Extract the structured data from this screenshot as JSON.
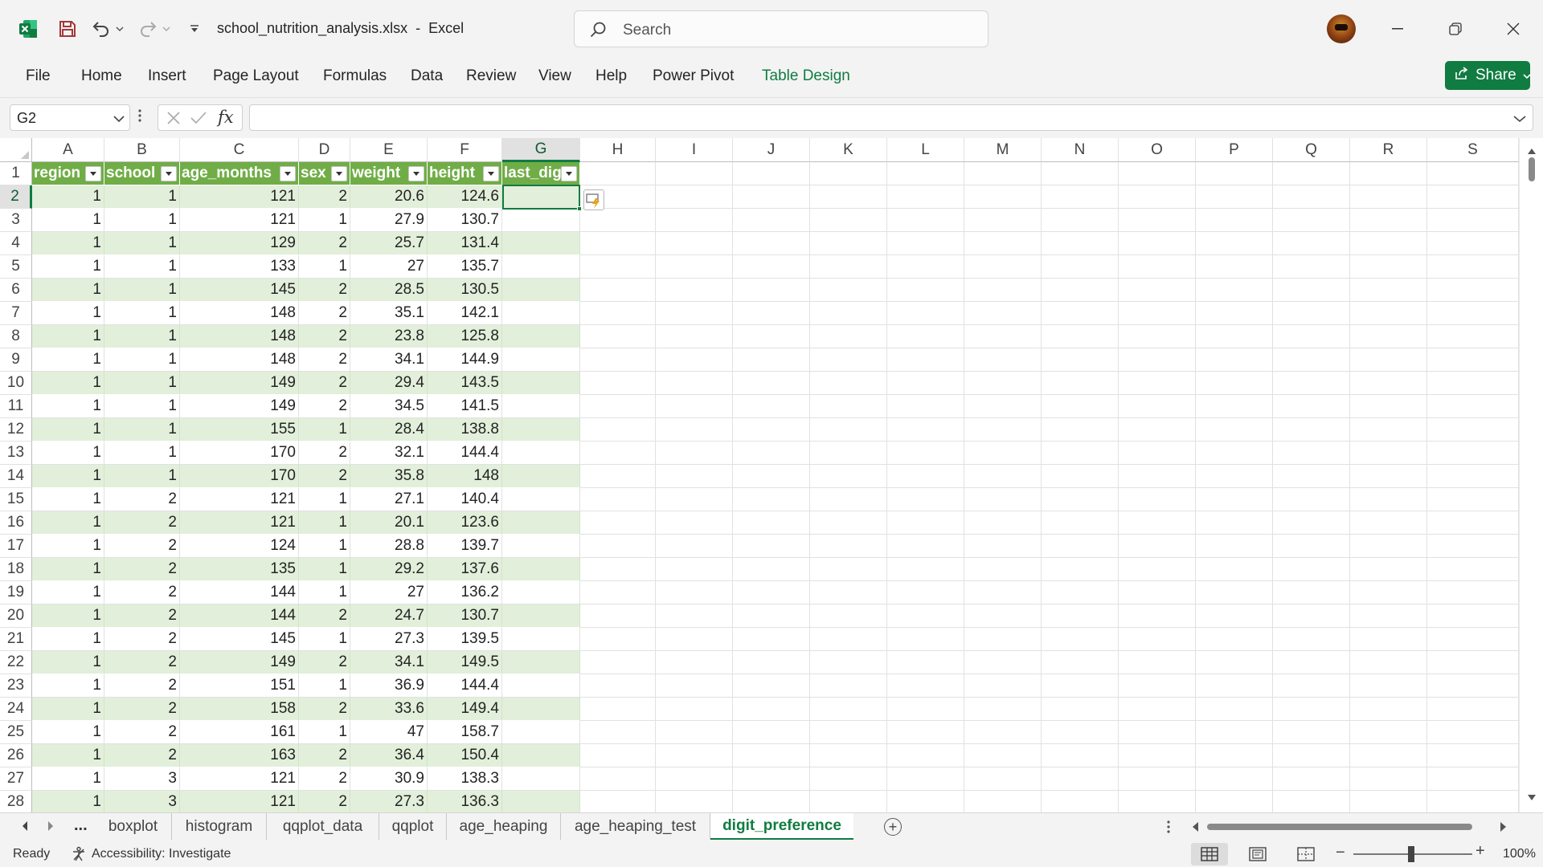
{
  "titlebar": {
    "filename": "school_nutrition_analysis.xlsx",
    "separator": "-",
    "app_name": "Excel",
    "search_placeholder": "Search"
  },
  "ribbon": {
    "tabs": [
      "File",
      "Home",
      "Insert",
      "Page Layout",
      "Formulas",
      "Data",
      "Review",
      "View",
      "Help",
      "Power Pivot",
      "Table Design"
    ],
    "active_contextual_tab": "Table Design",
    "share_label": "Share"
  },
  "formula_bar": {
    "name_box": "G2",
    "fx_label": "fx",
    "formula": ""
  },
  "grid": {
    "column_letters": [
      "A",
      "B",
      "C",
      "D",
      "E",
      "F",
      "G",
      "H",
      "I",
      "J",
      "K",
      "L",
      "M",
      "N",
      "O",
      "P",
      "Q",
      "R",
      "S"
    ],
    "selected_column": "G",
    "selected_row": "2",
    "table_headers": [
      "region",
      "school",
      "age_months",
      "sex",
      "weight",
      "height",
      "last_dig"
    ],
    "rows": [
      {
        "num": "2",
        "cells": [
          "1",
          "1",
          "121",
          "2",
          "20.6",
          "124.6",
          ""
        ]
      },
      {
        "num": "3",
        "cells": [
          "1",
          "1",
          "121",
          "1",
          "27.9",
          "130.7",
          ""
        ]
      },
      {
        "num": "4",
        "cells": [
          "1",
          "1",
          "129",
          "2",
          "25.7",
          "131.4",
          ""
        ]
      },
      {
        "num": "5",
        "cells": [
          "1",
          "1",
          "133",
          "1",
          "27",
          "135.7",
          ""
        ]
      },
      {
        "num": "6",
        "cells": [
          "1",
          "1",
          "145",
          "2",
          "28.5",
          "130.5",
          ""
        ]
      },
      {
        "num": "7",
        "cells": [
          "1",
          "1",
          "148",
          "2",
          "35.1",
          "142.1",
          ""
        ]
      },
      {
        "num": "8",
        "cells": [
          "1",
          "1",
          "148",
          "2",
          "23.8",
          "125.8",
          ""
        ]
      },
      {
        "num": "9",
        "cells": [
          "1",
          "1",
          "148",
          "2",
          "34.1",
          "144.9",
          ""
        ]
      },
      {
        "num": "10",
        "cells": [
          "1",
          "1",
          "149",
          "2",
          "29.4",
          "143.5",
          ""
        ]
      },
      {
        "num": "11",
        "cells": [
          "1",
          "1",
          "149",
          "2",
          "34.5",
          "141.5",
          ""
        ]
      },
      {
        "num": "12",
        "cells": [
          "1",
          "1",
          "155",
          "1",
          "28.4",
          "138.8",
          ""
        ]
      },
      {
        "num": "13",
        "cells": [
          "1",
          "1",
          "170",
          "2",
          "32.1",
          "144.4",
          ""
        ]
      },
      {
        "num": "14",
        "cells": [
          "1",
          "1",
          "170",
          "2",
          "35.8",
          "148",
          ""
        ]
      },
      {
        "num": "15",
        "cells": [
          "1",
          "2",
          "121",
          "1",
          "27.1",
          "140.4",
          ""
        ]
      },
      {
        "num": "16",
        "cells": [
          "1",
          "2",
          "121",
          "1",
          "20.1",
          "123.6",
          ""
        ]
      },
      {
        "num": "17",
        "cells": [
          "1",
          "2",
          "124",
          "1",
          "28.8",
          "139.7",
          ""
        ]
      },
      {
        "num": "18",
        "cells": [
          "1",
          "2",
          "135",
          "1",
          "29.2",
          "137.6",
          ""
        ]
      },
      {
        "num": "19",
        "cells": [
          "1",
          "2",
          "144",
          "1",
          "27",
          "136.2",
          ""
        ]
      },
      {
        "num": "20",
        "cells": [
          "1",
          "2",
          "144",
          "2",
          "24.7",
          "130.7",
          ""
        ]
      },
      {
        "num": "21",
        "cells": [
          "1",
          "2",
          "145",
          "1",
          "27.3",
          "139.5",
          ""
        ]
      },
      {
        "num": "22",
        "cells": [
          "1",
          "2",
          "149",
          "2",
          "34.1",
          "149.5",
          ""
        ]
      },
      {
        "num": "23",
        "cells": [
          "1",
          "2",
          "151",
          "1",
          "36.9",
          "144.4",
          ""
        ]
      },
      {
        "num": "24",
        "cells": [
          "1",
          "2",
          "158",
          "2",
          "33.6",
          "149.4",
          ""
        ]
      },
      {
        "num": "25",
        "cells": [
          "1",
          "2",
          "161",
          "1",
          "47",
          "158.7",
          ""
        ]
      },
      {
        "num": "26",
        "cells": [
          "1",
          "2",
          "163",
          "2",
          "36.4",
          "150.4",
          ""
        ]
      },
      {
        "num": "27",
        "cells": [
          "1",
          "3",
          "121",
          "2",
          "30.9",
          "138.3",
          ""
        ]
      },
      {
        "num": "28",
        "cells": [
          "1",
          "3",
          "121",
          "2",
          "27.3",
          "136.3",
          ""
        ]
      }
    ]
  },
  "sheet_tabs": {
    "more_label": "...",
    "tabs": [
      "boxplot",
      "histogram",
      "qqplot_data",
      "qqplot",
      "age_heaping",
      "age_heaping_test",
      "digit_preference"
    ],
    "active": "digit_preference"
  },
  "statusbar": {
    "ready": "Ready",
    "accessibility": "Accessibility: Investigate",
    "zoom": "100%"
  },
  "colors": {
    "accent": "#107c41",
    "table_header": "#70ad47",
    "table_band": "#e2efda"
  }
}
